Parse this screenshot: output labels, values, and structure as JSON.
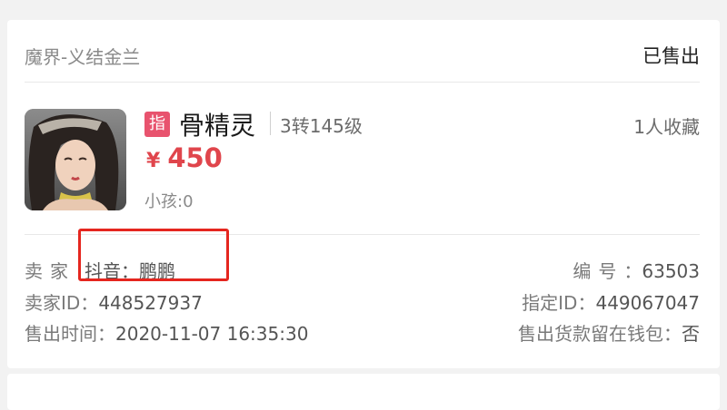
{
  "order": {
    "server": "魔界-义结金兰",
    "status": "已售出"
  },
  "item": {
    "tag": "指",
    "name": "骨精灵",
    "level": "3转145级",
    "favorites": "1人收藏",
    "price_symbol": "¥",
    "price": "450",
    "kids": "小孩:0"
  },
  "details": {
    "seller_label": "卖家",
    "seller_value": "抖音：鹏鹏",
    "number_label": "编号",
    "number_value": "63503",
    "seller_id_label": "卖家ID：",
    "seller_id_value": "448527937",
    "assigned_id_label": "指定ID：",
    "assigned_id_value": "449067047",
    "sold_time_label": "售出时间：",
    "sold_time_value": "2020-11-07 16:35:30",
    "wallet_label": "售出货款留在钱包：",
    "wallet_value": "否"
  },
  "colors": {
    "accent_price": "#e0454c",
    "tag_bg": "#e8536e",
    "highlight_box": "#e5261f"
  },
  "icons": {
    "avatar": "character-portrait"
  }
}
